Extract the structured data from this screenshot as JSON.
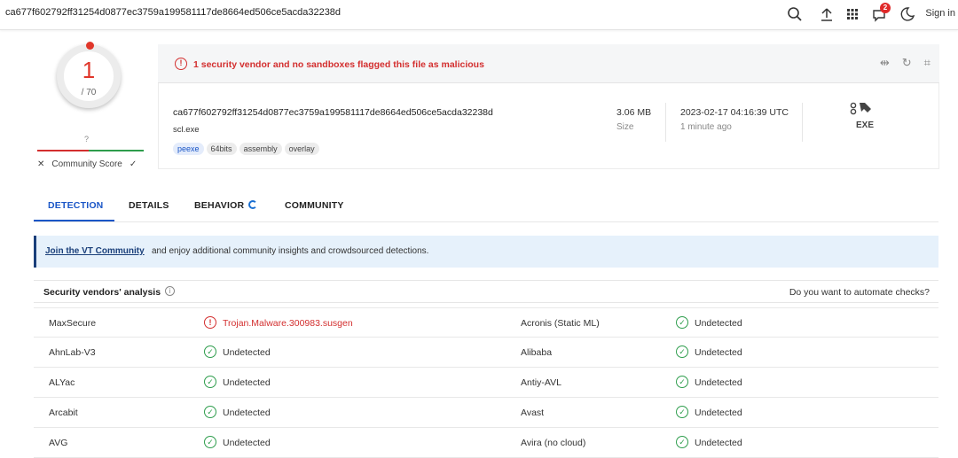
{
  "topbar": {
    "query": "ca677f602792ff31254d0877ec3759a199581117de8664ed506ce5acda32238d",
    "notification_count": "2",
    "signin_label": "Sign in"
  },
  "score": {
    "detections": "1",
    "total": "/ 70",
    "community_unknown": "?",
    "community_label": "Community Score"
  },
  "alert": {
    "icon": "!",
    "text": "1 security vendor and no sandboxes flagged this file as malicious"
  },
  "file": {
    "hash": "ca677f602792ff31254d0877ec3759a199581117de8664ed506ce5acda32238d",
    "name": "scl.exe",
    "tags": [
      "peexe",
      "64bits",
      "assembly",
      "overlay"
    ],
    "size_value": "3.06 MB",
    "size_label": "Size",
    "date_value": "2023-02-17 04:16:39 UTC",
    "date_label": "1 minute ago",
    "type_label": "EXE"
  },
  "tabs": [
    "DETECTION",
    "DETAILS",
    "BEHAVIOR",
    "COMMUNITY"
  ],
  "banner": {
    "link": "Join the VT Community",
    "text": "and enjoy additional community insights and crowdsourced detections."
  },
  "vendors_header": {
    "title": "Security vendors' analysis",
    "info": "i",
    "automate": "Do you want to automate checks?"
  },
  "vendors": [
    {
      "left_name": "MaxSecure",
      "left_result": "Trojan.Malware.300983.susgen",
      "left_status": "malicious",
      "right_name": "Acronis (Static ML)",
      "right_result": "Undetected"
    },
    {
      "left_name": "AhnLab-V3",
      "left_result": "Undetected",
      "left_status": "clean",
      "right_name": "Alibaba",
      "right_result": "Undetected"
    },
    {
      "left_name": "ALYac",
      "left_result": "Undetected",
      "left_status": "clean",
      "right_name": "Antiy-AVL",
      "right_result": "Undetected"
    },
    {
      "left_name": "Arcabit",
      "left_result": "Undetected",
      "left_status": "clean",
      "right_name": "Avast",
      "right_result": "Undetected"
    },
    {
      "left_name": "AVG",
      "left_result": "Undetected",
      "left_status": "clean",
      "right_name": "Avira (no cloud)",
      "right_result": "Undetected"
    }
  ],
  "colors": {
    "accent": "#1a56c7",
    "danger": "#d32f2f",
    "ok": "#2e9d4c"
  }
}
